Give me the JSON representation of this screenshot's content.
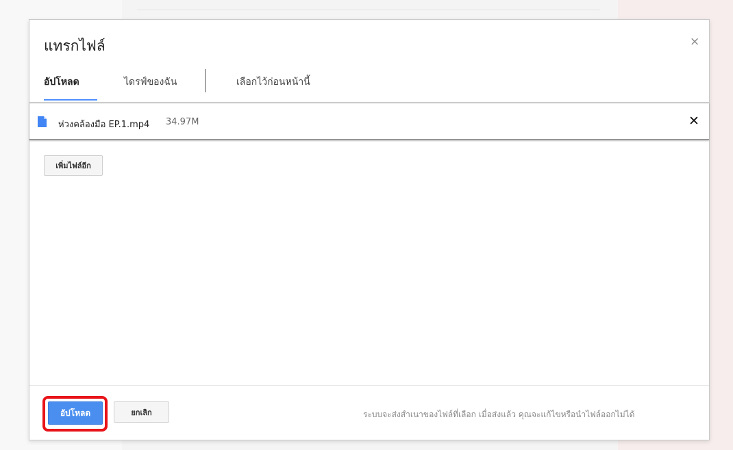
{
  "dialog": {
    "title": "แทรกไฟล์",
    "close_symbol": "×"
  },
  "tabs": [
    {
      "label": "อัปโหลด",
      "active": true
    },
    {
      "label": "ไดรฟ์ของฉัน",
      "active": false
    },
    {
      "label": "เลือกไว้ก่อนหน้านี้",
      "active": false
    }
  ],
  "file": {
    "icon": "file-icon",
    "icon_color": "#4285f4",
    "name": "ห่วงคล้องมือ EP.1.mp4",
    "size": "34.97M",
    "remove_symbol": "✕"
  },
  "buttons": {
    "add_more": "เพิ่มไฟล์อีก",
    "upload": "อัปโหลด",
    "cancel": "ยกเลิก"
  },
  "footer": {
    "note": "ระบบจะส่งสำเนาของไฟล์ที่เลือก เมื่อส่งแล้ว คุณจะแก้ไขหรือนำไฟล์ออกไม่ได้"
  },
  "colors": {
    "accent": "#4a8ff0",
    "highlight": "#e8141a"
  }
}
